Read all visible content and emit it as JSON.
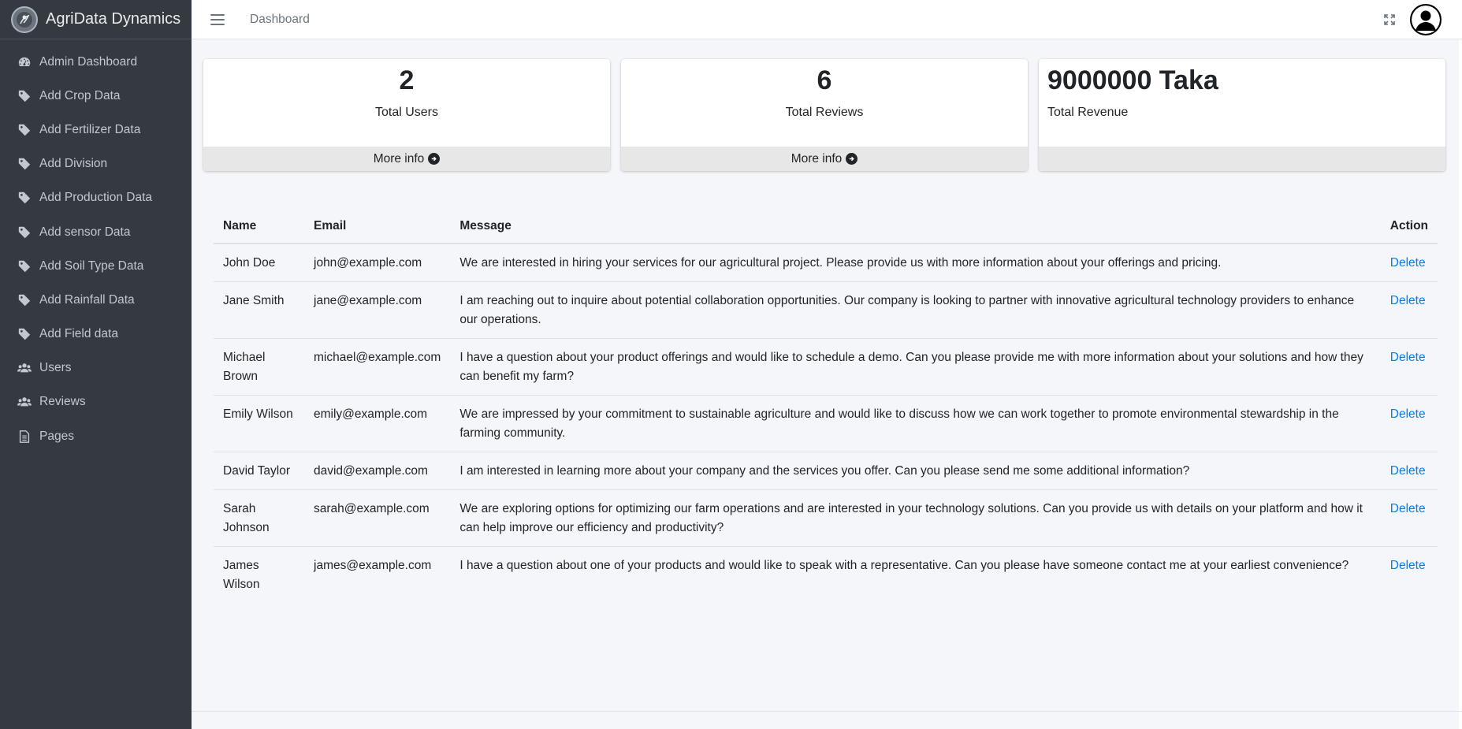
{
  "brand": {
    "name": "AgriData Dynamics"
  },
  "sidebar": {
    "items": [
      {
        "label": "Admin Dashboard",
        "icon": "dashboard-icon"
      },
      {
        "label": "Add Crop Data",
        "icon": "tag-icon"
      },
      {
        "label": "Add Fertilizer Data",
        "icon": "tag-icon"
      },
      {
        "label": "Add Division",
        "icon": "tag-icon"
      },
      {
        "label": "Add Production Data",
        "icon": "tag-icon"
      },
      {
        "label": "Add sensor Data",
        "icon": "tag-icon"
      },
      {
        "label": "Add Soil Type Data",
        "icon": "tag-icon"
      },
      {
        "label": "Add Rainfall Data",
        "icon": "tag-icon"
      },
      {
        "label": "Add Field data",
        "icon": "tag-icon"
      },
      {
        "label": "Users",
        "icon": "users-icon"
      },
      {
        "label": "Reviews",
        "icon": "users-icon"
      },
      {
        "label": "Pages",
        "icon": "file-icon"
      }
    ]
  },
  "header": {
    "link": "Dashboard"
  },
  "cards": [
    {
      "value": "2",
      "label": "Total Users",
      "footer": "More info"
    },
    {
      "value": "6",
      "label": "Total Reviews",
      "footer": "More info"
    },
    {
      "value": "9000000 Taka",
      "label": "Total Revenue",
      "footer": ""
    }
  ],
  "table": {
    "headers": {
      "name": "Name",
      "email": "Email",
      "message": "Message",
      "action": "Action"
    },
    "rows": [
      {
        "name": "John Doe",
        "email": "john@example.com",
        "message": "We are interested in hiring your services for our agricultural project. Please provide us with more information about your offerings and pricing.",
        "action": "Delete"
      },
      {
        "name": "Jane Smith",
        "email": "jane@example.com",
        "message": "I am reaching out to inquire about potential collaboration opportunities. Our company is looking to partner with innovative agricultural technology providers to enhance our operations.",
        "action": "Delete"
      },
      {
        "name": "Michael Brown",
        "email": "michael@example.com",
        "message": "I have a question about your product offerings and would like to schedule a demo. Can you please provide me with more information about your solutions and how they can benefit my farm?",
        "action": "Delete"
      },
      {
        "name": "Emily Wilson",
        "email": "emily@example.com",
        "message": "We are impressed by your commitment to sustainable agriculture and would like to discuss how we can work together to promote environmental stewardship in the farming community.",
        "action": "Delete"
      },
      {
        "name": "David Taylor",
        "email": "david@example.com",
        "message": "I am interested in learning more about your company and the services you offer. Can you please send me some additional information?",
        "action": "Delete"
      },
      {
        "name": "Sarah Johnson",
        "email": "sarah@example.com",
        "message": "We are exploring options for optimizing our farm operations and are interested in your technology solutions. Can you provide us with details on your platform and how it can help improve our efficiency and productivity?",
        "action": "Delete"
      },
      {
        "name": "James Wilson",
        "email": "james@example.com",
        "message": "I have a question about one of your products and would like to speak with a representative. Can you please have someone contact me at your earliest convenience?",
        "action": "Delete"
      }
    ]
  },
  "colors": {
    "sidebar_bg": "#343a40",
    "link": "#007bff",
    "content_bg": "#f4f6f9",
    "card_footer_bg": "#e7e7e7"
  }
}
